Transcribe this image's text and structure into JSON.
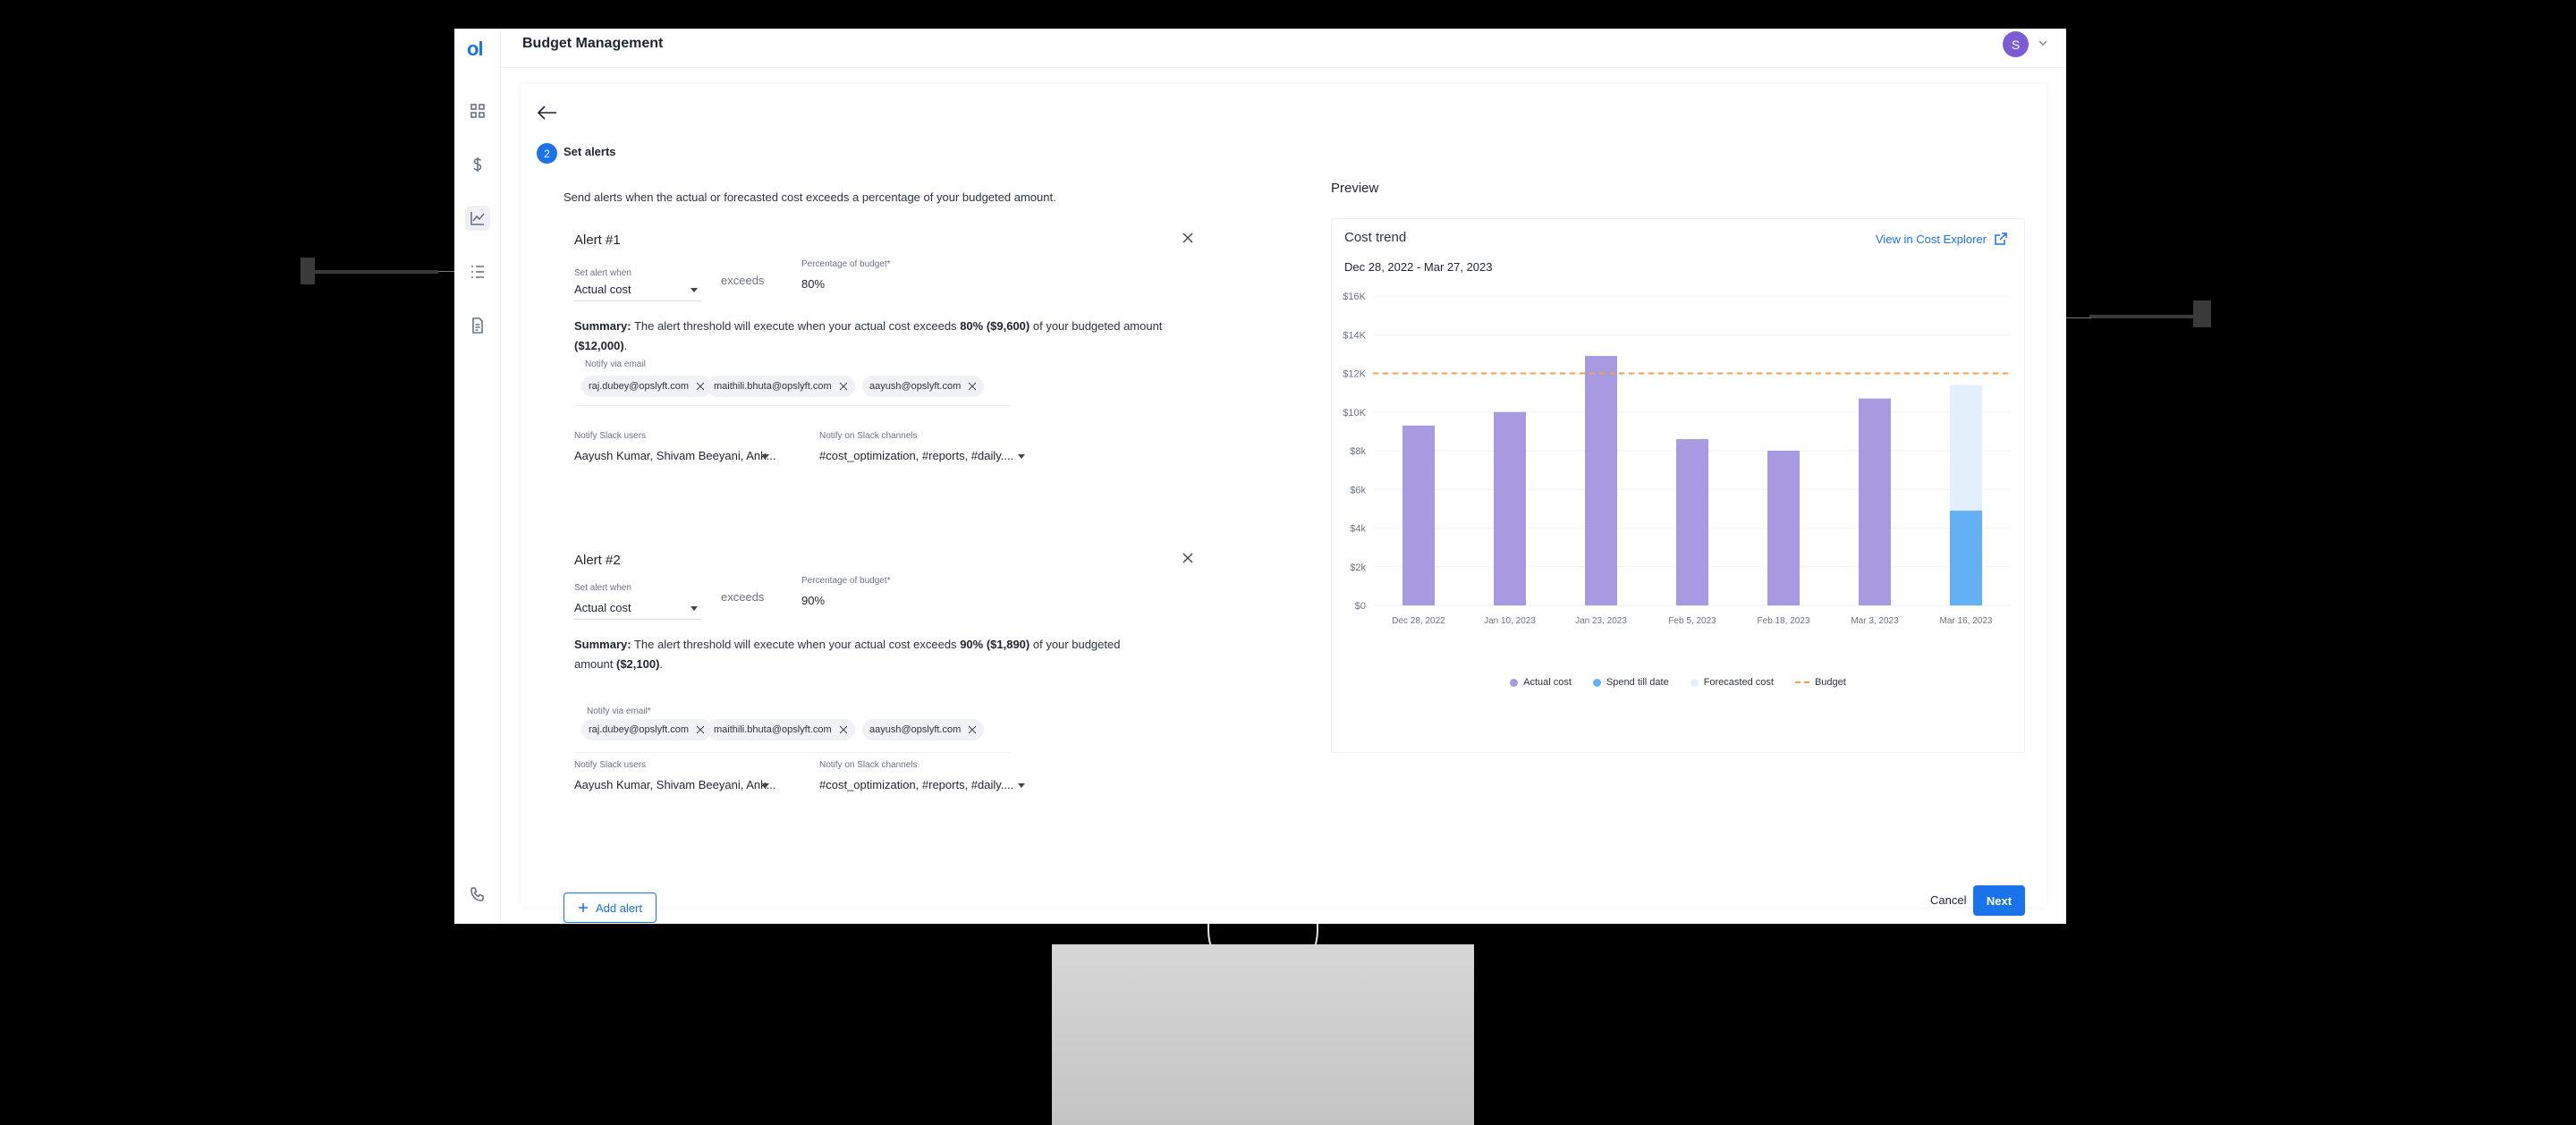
{
  "app": {
    "logo": "ol",
    "title": "Budget Management",
    "avatar_initial": "S"
  },
  "sidebar": {
    "items": [
      "dashboard-icon",
      "dollar-icon",
      "chart-icon",
      "list-icon",
      "document-icon",
      "phone-icon"
    ]
  },
  "step": {
    "number": "2",
    "title": "Set alerts"
  },
  "intro": "Send alerts when the actual or forecasted cost exceeds a percentage of your budgeted amount.",
  "alerts": [
    {
      "title": "Alert #1",
      "set_alert_label": "Set alert when",
      "set_alert_value": "Actual cost",
      "exceeds": "exceeds",
      "percent_label": "Percentage of budget*",
      "percent_value": "80%",
      "summary_label": "Summary:",
      "summary_a": "The alert threshold will execute when your actual cost exceeds",
      "summary_pct": "80% ($9,600)",
      "summary_b": "of your budgeted amount",
      "summary_amt": "($12,000)",
      "summary_end": ".",
      "email_label": "Notify via email",
      "emails": [
        "raj.dubey@opslyft.com",
        "maithili.bhuta@opslyft.com",
        "aayush@opslyft.com"
      ],
      "slack_users_label": "Notify Slack users",
      "slack_users_value": "Aayush Kumar, Shivam Beeyani, Ank...",
      "slack_channels_label": "Notify on Slack channels",
      "slack_channels_value": "#cost_optimization, #reports, #daily...."
    },
    {
      "title": "Alert #2",
      "set_alert_label": "Set alert when",
      "set_alert_value": "Actual cost",
      "exceeds": "exceeds",
      "percent_label": "Percentage of budget*",
      "percent_value": "90%",
      "summary_label": "Summary:",
      "summary_a": "The alert threshold will execute when your actual cost exceeds",
      "summary_pct": "90% ($1,890)",
      "summary_b": "of your budgeted amount",
      "summary_amt": "($2,100)",
      "summary_end": ".",
      "email_label": "Notify via email*",
      "emails": [
        "raj.dubey@opslyft.com",
        "maithili.bhuta@opslyft.com",
        "aayush@opslyft.com"
      ],
      "slack_users_label": "Notify Slack users",
      "slack_users_value": "Aayush Kumar, Shivam Beeyani, Ank...",
      "slack_channels_label": "Notify on Slack channels",
      "slack_channels_value": "#cost_optimization, #reports, #daily...."
    }
  ],
  "actions": {
    "add_alert": "Add alert",
    "cancel": "Cancel",
    "next": "Next"
  },
  "preview": {
    "title": "Preview",
    "card_title": "Cost trend",
    "explorer_link": "View in Cost Explorer",
    "date_range": "Dec 28, 2022 - Mar 27, 2023"
  },
  "colors": {
    "accent": "#1a73e8",
    "actual": "#a89ae0",
    "spend": "#64b0f5",
    "forecast": "#e3effb",
    "budget": "#f5a04a"
  },
  "chart_data": {
    "type": "bar",
    "categories": [
      "Dec 28, 2022",
      "Jan 10, 2023",
      "Jan 23, 2023",
      "Feb 5, 2023",
      "Feb 18, 2023",
      "Mar 3, 2023",
      "Mar 16, 2023"
    ],
    "series": [
      {
        "name": "Actual cost",
        "values": [
          9300,
          10000,
          12900,
          8600,
          8000,
          10700,
          null
        ]
      },
      {
        "name": "Spend till date",
        "values": [
          null,
          null,
          null,
          null,
          null,
          null,
          4900
        ]
      },
      {
        "name": "Forecasted cost",
        "values": [
          null,
          null,
          null,
          null,
          null,
          null,
          6500
        ]
      }
    ],
    "budget": {
      "name": "Budget",
      "value": 12000
    },
    "y_ticks": [
      "$0",
      "$2k",
      "$4k",
      "$6k",
      "$8k",
      "$10K",
      "$12K",
      "$14K",
      "$16K"
    ],
    "ylim": [
      0,
      16000
    ],
    "legend_position": "bottom",
    "grid": true
  }
}
